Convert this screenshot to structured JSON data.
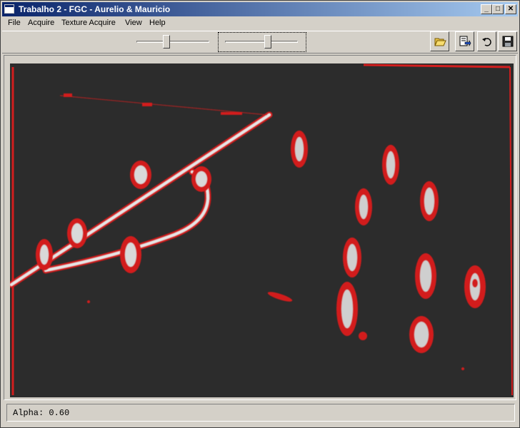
{
  "window": {
    "title": "Trabalho 2 - FGC - Aurelio & Mauricio",
    "controls": {
      "minimize": "_",
      "maximize": "□",
      "close": "✕"
    }
  },
  "menu": [
    "File",
    "Acquire",
    "Texture Acquire",
    "View",
    "Help"
  ],
  "toolbar": {
    "slider1_value": 0.4,
    "slider2_value": 0.6,
    "buttons": [
      "open-folder-icon",
      "export-icon",
      "undo-icon",
      "save-icon"
    ]
  },
  "status": {
    "text": "Alpha: 0.60"
  },
  "colors": {
    "edge_overlay": "#d21e1e",
    "image_background": "#2a2a2a",
    "title_gradient_start": "#0a246a"
  }
}
